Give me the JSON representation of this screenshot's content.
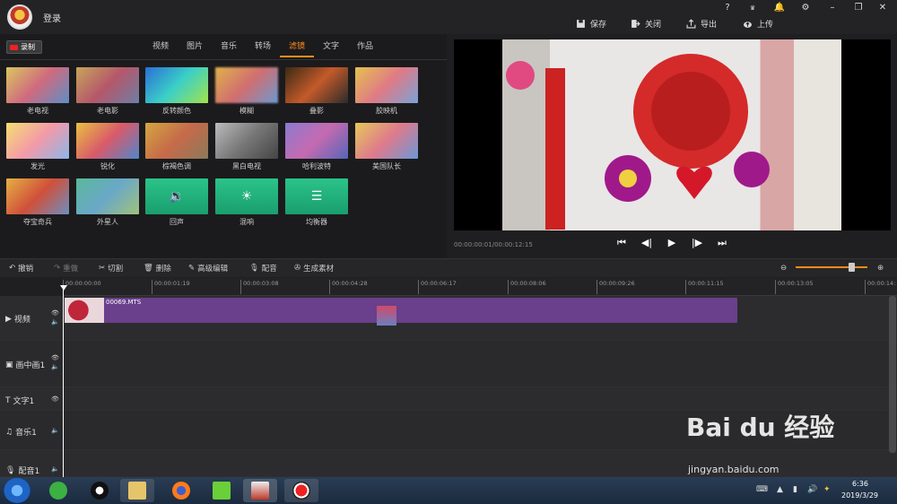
{
  "titlebar": {
    "login": "登录",
    "save": "保存",
    "close": "关闭",
    "export": "导出",
    "upload": "上传",
    "help": "?",
    "vip": "VIP"
  },
  "record_label": "录制",
  "tabs": [
    {
      "label": "视频"
    },
    {
      "label": "图片"
    },
    {
      "label": "音乐"
    },
    {
      "label": "转场"
    },
    {
      "label": "滤镜",
      "active": true
    },
    {
      "label": "文字"
    },
    {
      "label": "作品"
    }
  ],
  "filters": [
    {
      "label": "老电视"
    },
    {
      "label": "老电影"
    },
    {
      "label": "反转颜色"
    },
    {
      "label": "模糊"
    },
    {
      "label": "叠影"
    },
    {
      "label": "胶映机"
    },
    {
      "label": "发光"
    },
    {
      "label": "锐化"
    },
    {
      "label": "棕褐色调"
    },
    {
      "label": "黑白电视"
    },
    {
      "label": "哈利波特"
    },
    {
      "label": "美国队长"
    },
    {
      "label": "夺宝奇兵"
    },
    {
      "label": "外星人"
    },
    {
      "label": "回声"
    },
    {
      "label": "混响"
    },
    {
      "label": "均衡器"
    }
  ],
  "preview": {
    "time": "00:00:00:01/00:00:12:15"
  },
  "toolbar": {
    "undo": "撤销",
    "redo": "重做",
    "cut": "切割",
    "delete": "删除",
    "advanced": "高级编辑",
    "dub": "配音",
    "generate": "生成素材",
    "zoom_level": 0.81
  },
  "ruler": [
    "00:00:00:00",
    "00:00:01:19",
    "00:00:03:08",
    "00:00:04:28",
    "00:00:06:17",
    "00:00:08:06",
    "00:00:09:26",
    "00:00:11:15",
    "00:00:13:05",
    "00:00:14:"
  ],
  "tracks": {
    "video": "视频",
    "pip": "画中画1",
    "text": "文字1",
    "music": "音乐1",
    "voice": "配音1"
  },
  "clip": {
    "name": "00069.MTS"
  },
  "taskbar": {
    "time": "6:36",
    "date": "2019/3/29"
  },
  "watermark": {
    "logo": "Bai du 经验",
    "url": "jingyan.baidu.com"
  }
}
